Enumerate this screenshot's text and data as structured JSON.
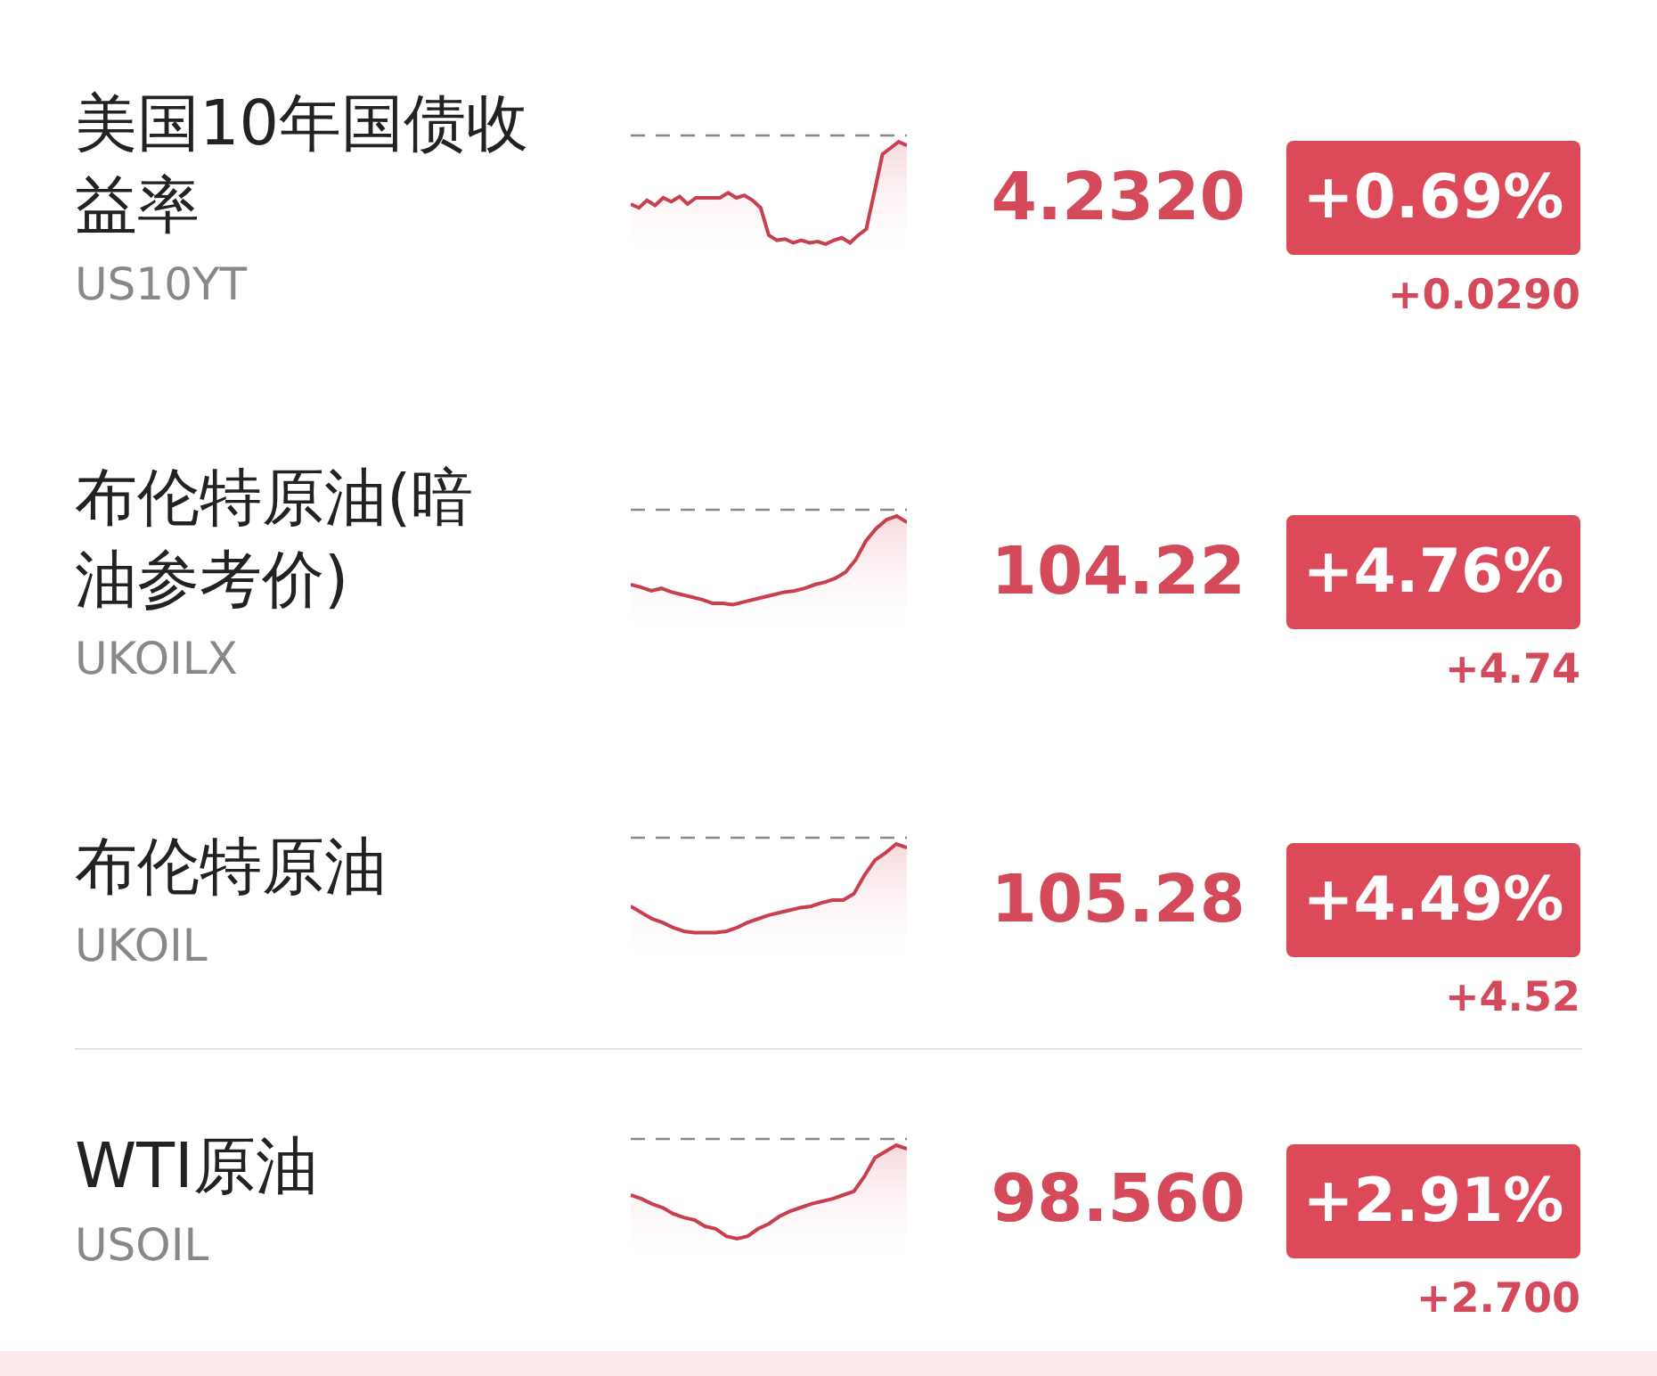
{
  "quotes": [
    {
      "name": "美国10年国债收益率",
      "symbol": "US10YT",
      "price": "4.2320",
      "change_percent": "+0.69%",
      "change": "+0.0290"
    },
    {
      "name": "布伦特原油(暗油参考价)",
      "symbol": "UKOILX",
      "price": "104.22",
      "change_percent": "+4.76%",
      "change": "+4.74"
    },
    {
      "name": "布伦特原油",
      "symbol": "UKOIL",
      "price": "105.28",
      "change_percent": "+4.49%",
      "change": "+4.52"
    },
    {
      "name": "WTI原油",
      "symbol": "USOIL",
      "price": "98.560",
      "change_percent": "+2.91%",
      "change": "+2.700"
    }
  ]
}
